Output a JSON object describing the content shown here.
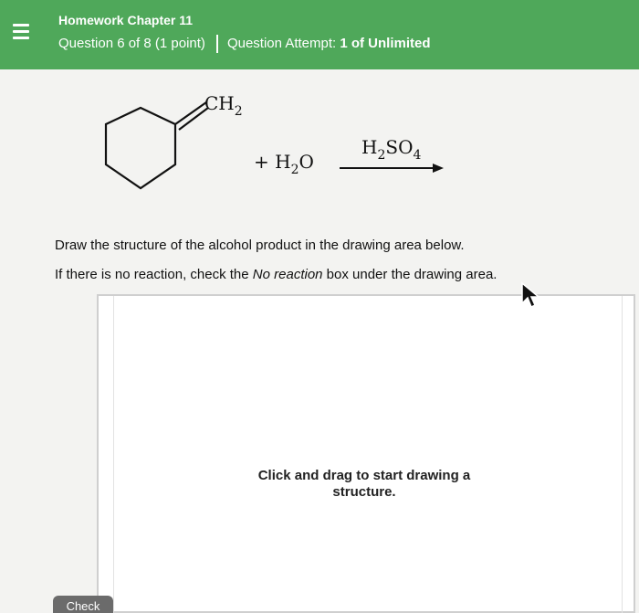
{
  "header": {
    "menu_icon": "hamburger-menu-icon",
    "title": "Homework Chapter 11",
    "question_info": "Question 6 of 8 (1 point)",
    "attempt_label": "Question Attempt:",
    "attempt_value": "1 of Unlimited",
    "color": "#4fa85a"
  },
  "reaction": {
    "substituent": "CH",
    "substituent_sub": "2",
    "plus": "+ H",
    "water_sub": "2",
    "water_tail": "O",
    "reagent_h": "H",
    "reagent_h_sub": "2",
    "reagent_so": "SO",
    "reagent_so_sub": "4"
  },
  "instructions": {
    "line1": "Draw the structure of the alcohol product in the drawing area below.",
    "line2_pre": "If there is no reaction, check the ",
    "line2_em": "No reaction",
    "line2_post": " box under the drawing area."
  },
  "drawing_area": {
    "hint": "Click and drag to start drawing a structure."
  },
  "buttons": {
    "check": "Check"
  }
}
